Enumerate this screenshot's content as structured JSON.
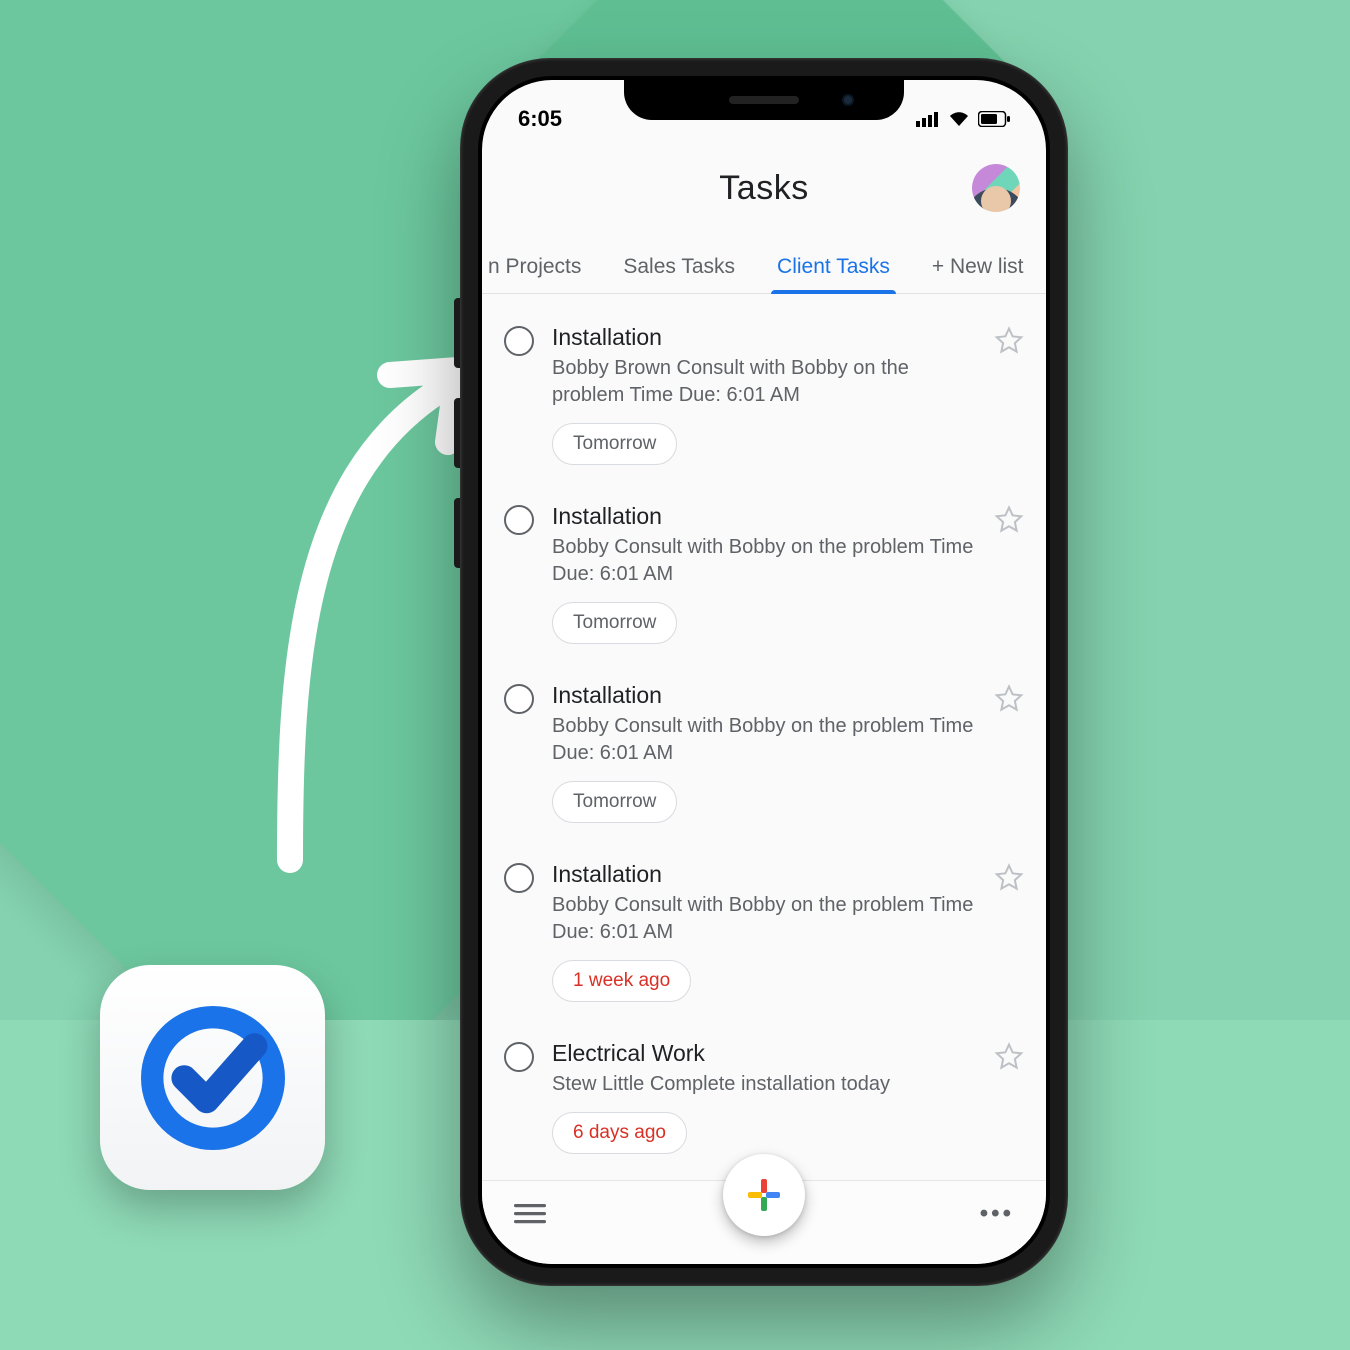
{
  "status": {
    "time": "6:05"
  },
  "header": {
    "title": "Tasks"
  },
  "tabs": {
    "items": [
      {
        "label": "n Projects",
        "active": false,
        "partial": true
      },
      {
        "label": "Sales Tasks",
        "active": false
      },
      {
        "label": "Client Tasks",
        "active": true
      },
      {
        "label": "+ New list",
        "active": false
      }
    ]
  },
  "tasks": [
    {
      "title": "Installation",
      "desc": "Bobby Brown Consult with Bobby on the problem Time Due: 6:01 AM",
      "chip": "Tomorrow",
      "overdue": false
    },
    {
      "title": "Installation",
      "desc": "Bobby Consult with Bobby on the problem Time Due: 6:01 AM",
      "chip": "Tomorrow",
      "overdue": false
    },
    {
      "title": "Installation",
      "desc": "Bobby Consult with Bobby on the problem Time Due: 6:01 AM",
      "chip": "Tomorrow",
      "overdue": false
    },
    {
      "title": "Installation",
      "desc": "Bobby Consult with Bobby on the problem Time Due: 6:01 AM",
      "chip": "1 week ago",
      "overdue": true
    },
    {
      "title": "Electrical Work",
      "desc": "Stew Little Complete installation today",
      "chip": "6 days ago",
      "overdue": true
    }
  ]
}
